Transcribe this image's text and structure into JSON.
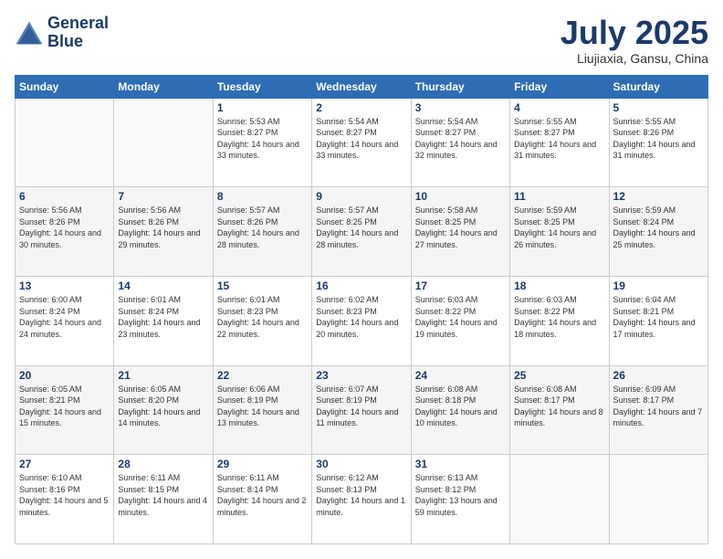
{
  "logo": {
    "line1": "General",
    "line2": "Blue"
  },
  "title": "July 2025",
  "location": "Liujiaxia, Gansu, China",
  "weekdays": [
    "Sunday",
    "Monday",
    "Tuesday",
    "Wednesday",
    "Thursday",
    "Friday",
    "Saturday"
  ],
  "weeks": [
    [
      {
        "day": "",
        "info": ""
      },
      {
        "day": "",
        "info": ""
      },
      {
        "day": "1",
        "info": "Sunrise: 5:53 AM\nSunset: 8:27 PM\nDaylight: 14 hours and 33 minutes."
      },
      {
        "day": "2",
        "info": "Sunrise: 5:54 AM\nSunset: 8:27 PM\nDaylight: 14 hours and 33 minutes."
      },
      {
        "day": "3",
        "info": "Sunrise: 5:54 AM\nSunset: 8:27 PM\nDaylight: 14 hours and 32 minutes."
      },
      {
        "day": "4",
        "info": "Sunrise: 5:55 AM\nSunset: 8:27 PM\nDaylight: 14 hours and 31 minutes."
      },
      {
        "day": "5",
        "info": "Sunrise: 5:55 AM\nSunset: 8:26 PM\nDaylight: 14 hours and 31 minutes."
      }
    ],
    [
      {
        "day": "6",
        "info": "Sunrise: 5:56 AM\nSunset: 8:26 PM\nDaylight: 14 hours and 30 minutes."
      },
      {
        "day": "7",
        "info": "Sunrise: 5:56 AM\nSunset: 8:26 PM\nDaylight: 14 hours and 29 minutes."
      },
      {
        "day": "8",
        "info": "Sunrise: 5:57 AM\nSunset: 8:26 PM\nDaylight: 14 hours and 28 minutes."
      },
      {
        "day": "9",
        "info": "Sunrise: 5:57 AM\nSunset: 8:25 PM\nDaylight: 14 hours and 28 minutes."
      },
      {
        "day": "10",
        "info": "Sunrise: 5:58 AM\nSunset: 8:25 PM\nDaylight: 14 hours and 27 minutes."
      },
      {
        "day": "11",
        "info": "Sunrise: 5:59 AM\nSunset: 8:25 PM\nDaylight: 14 hours and 26 minutes."
      },
      {
        "day": "12",
        "info": "Sunrise: 5:59 AM\nSunset: 8:24 PM\nDaylight: 14 hours and 25 minutes."
      }
    ],
    [
      {
        "day": "13",
        "info": "Sunrise: 6:00 AM\nSunset: 8:24 PM\nDaylight: 14 hours and 24 minutes."
      },
      {
        "day": "14",
        "info": "Sunrise: 6:01 AM\nSunset: 8:24 PM\nDaylight: 14 hours and 23 minutes."
      },
      {
        "day": "15",
        "info": "Sunrise: 6:01 AM\nSunset: 8:23 PM\nDaylight: 14 hours and 22 minutes."
      },
      {
        "day": "16",
        "info": "Sunrise: 6:02 AM\nSunset: 8:23 PM\nDaylight: 14 hours and 20 minutes."
      },
      {
        "day": "17",
        "info": "Sunrise: 6:03 AM\nSunset: 8:22 PM\nDaylight: 14 hours and 19 minutes."
      },
      {
        "day": "18",
        "info": "Sunrise: 6:03 AM\nSunset: 8:22 PM\nDaylight: 14 hours and 18 minutes."
      },
      {
        "day": "19",
        "info": "Sunrise: 6:04 AM\nSunset: 8:21 PM\nDaylight: 14 hours and 17 minutes."
      }
    ],
    [
      {
        "day": "20",
        "info": "Sunrise: 6:05 AM\nSunset: 8:21 PM\nDaylight: 14 hours and 15 minutes."
      },
      {
        "day": "21",
        "info": "Sunrise: 6:05 AM\nSunset: 8:20 PM\nDaylight: 14 hours and 14 minutes."
      },
      {
        "day": "22",
        "info": "Sunrise: 6:06 AM\nSunset: 8:19 PM\nDaylight: 14 hours and 13 minutes."
      },
      {
        "day": "23",
        "info": "Sunrise: 6:07 AM\nSunset: 8:19 PM\nDaylight: 14 hours and 11 minutes."
      },
      {
        "day": "24",
        "info": "Sunrise: 6:08 AM\nSunset: 8:18 PM\nDaylight: 14 hours and 10 minutes."
      },
      {
        "day": "25",
        "info": "Sunrise: 6:08 AM\nSunset: 8:17 PM\nDaylight: 14 hours and 8 minutes."
      },
      {
        "day": "26",
        "info": "Sunrise: 6:09 AM\nSunset: 8:17 PM\nDaylight: 14 hours and 7 minutes."
      }
    ],
    [
      {
        "day": "27",
        "info": "Sunrise: 6:10 AM\nSunset: 8:16 PM\nDaylight: 14 hours and 5 minutes."
      },
      {
        "day": "28",
        "info": "Sunrise: 6:11 AM\nSunset: 8:15 PM\nDaylight: 14 hours and 4 minutes."
      },
      {
        "day": "29",
        "info": "Sunrise: 6:11 AM\nSunset: 8:14 PM\nDaylight: 14 hours and 2 minutes."
      },
      {
        "day": "30",
        "info": "Sunrise: 6:12 AM\nSunset: 8:13 PM\nDaylight: 14 hours and 1 minute."
      },
      {
        "day": "31",
        "info": "Sunrise: 6:13 AM\nSunset: 8:12 PM\nDaylight: 13 hours and 59 minutes."
      },
      {
        "day": "",
        "info": ""
      },
      {
        "day": "",
        "info": ""
      }
    ]
  ]
}
